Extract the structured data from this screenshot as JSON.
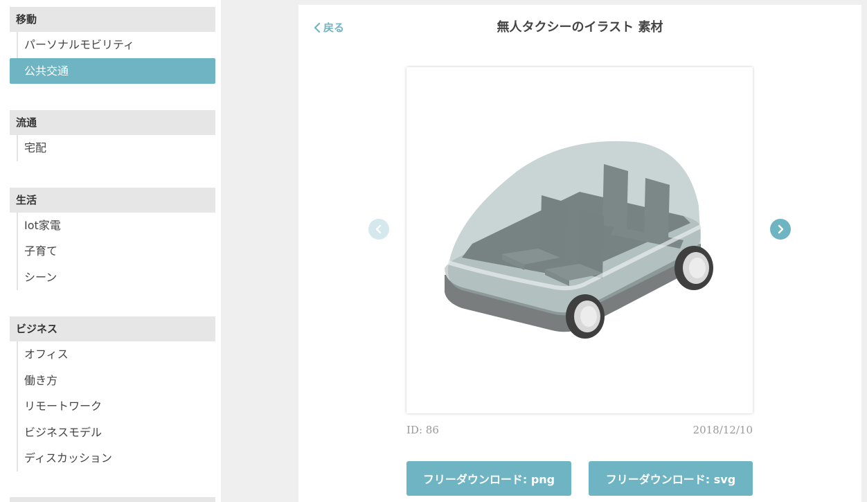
{
  "sidebar": {
    "categories": [
      {
        "title": "移動",
        "items": [
          "パーソナルモビリティ",
          "公共交通"
        ]
      },
      {
        "title": "流通",
        "items": [
          "宅配"
        ]
      },
      {
        "title": "生活",
        "items": [
          "Iot家電",
          "子育て",
          "シーン"
        ]
      },
      {
        "title": "ビジネス",
        "items": [
          "オフィス",
          "働き方",
          "リモートワーク",
          "ビジネスモデル",
          "ディスカッション"
        ]
      }
    ],
    "active_item": "公共交通"
  },
  "main": {
    "back_label": "戻る",
    "title": "無人タクシーのイラスト 素材",
    "id_label": "ID: 86",
    "date": "2018/12/10",
    "download_png": "フリーダウンロード: png",
    "download_svg": "フリーダウンロード: svg"
  },
  "colors": {
    "accent": "#6fb4c2",
    "category_bg": "#e6e6e6",
    "page_bg": "#efefef"
  }
}
